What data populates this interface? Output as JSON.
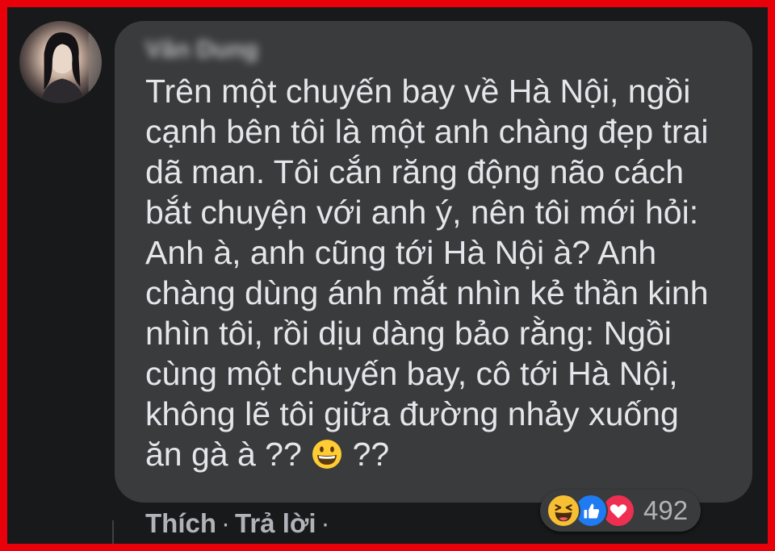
{
  "comment": {
    "author": "Vân Dung",
    "text_main": "Trên một chuyến bay về Hà Nội, ngồi\ncạnh bên tôi là một anh chàng đẹp trai\ndã man. Tôi cắn răng động não cách\nbắt chuyện với anh ý, nên tôi mới hỏi:\nAnh à, anh cũng tới Hà Nội à? Anh\nchàng dùng ánh mắt nhìn kẻ thần kinh\nnhìn tôi, rồi dịu dàng bảo rằng: Ngồi\ncùng một chuyến bay, cô tới Hà Nội,\nkhông lẽ tôi giữa đường nhảy xuống\năn gà à ?? ",
    "text_tail": " ??",
    "emoji_icon": "grinning-face-icon"
  },
  "reactions": {
    "icons": [
      "haha-icon",
      "like-icon",
      "love-icon"
    ],
    "count": "492"
  },
  "actions": {
    "like_label": "Thích",
    "separator": "·",
    "reply_label": "Trả lời",
    "trailing_separator": "·"
  },
  "colors": {
    "frame_border": "#e8000b",
    "background": "#18191a",
    "bubble": "#3a3b3c",
    "text": "#e4e6eb",
    "secondary_text": "#b0b3b8",
    "like_blue": "#1f7bf2",
    "love_red": "#ef2f52",
    "haha_yellow": "#f7c034"
  }
}
